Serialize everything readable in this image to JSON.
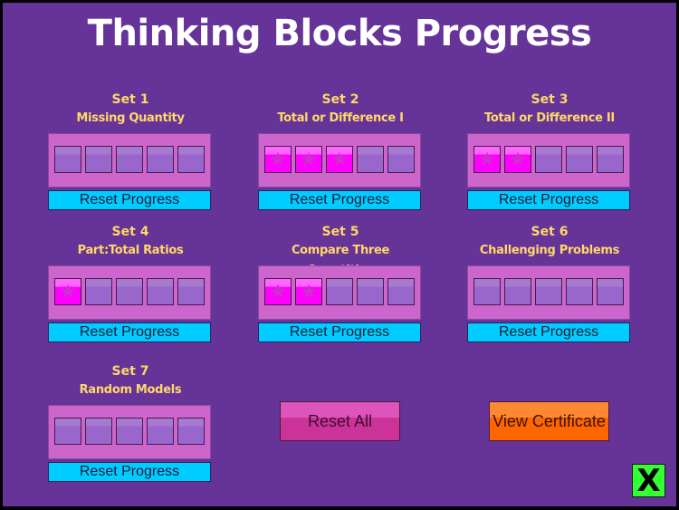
{
  "title": "Thinking Blocks Progress",
  "colors": {
    "background": "#663399",
    "heading_text": "#FFD966",
    "tray": "#CC66CC",
    "block_empty": "#9966CC",
    "block_filled": "#FF00FF",
    "reset_button": "#00CCFF",
    "reset_all_button": "#CC3399",
    "view_certificate_button": "#FF6600",
    "close_button": "#33FF33"
  },
  "sets": [
    {
      "number": "Set 1",
      "name": "Missing Quantity",
      "completed": 0,
      "total": 5,
      "reset_label": "Reset Progress"
    },
    {
      "number": "Set 2",
      "name": "Total or Difference I",
      "completed": 3,
      "total": 5,
      "reset_label": "Reset Progress"
    },
    {
      "number": "Set 3",
      "name": "Total or Difference II",
      "completed": 2,
      "total": 5,
      "reset_label": "Reset Progress"
    },
    {
      "number": "Set 4",
      "name": "Part:Total Ratios",
      "completed": 1,
      "total": 5,
      "reset_label": "Reset Progress"
    },
    {
      "number": "Set 5",
      "name": "Compare Three Quantities",
      "completed": 2,
      "total": 5,
      "reset_label": "Reset Progress"
    },
    {
      "number": "Set 6",
      "name": "Challenging Problems",
      "completed": 0,
      "total": 5,
      "reset_label": "Reset Progress"
    },
    {
      "number": "Set 7",
      "name": "Random Models",
      "completed": 0,
      "total": 5,
      "reset_label": "Reset Progress"
    }
  ],
  "block_icon": "star-icon",
  "buttons": {
    "reset_all": "Reset All",
    "view_certificate": "View Certificate",
    "close": "X"
  }
}
